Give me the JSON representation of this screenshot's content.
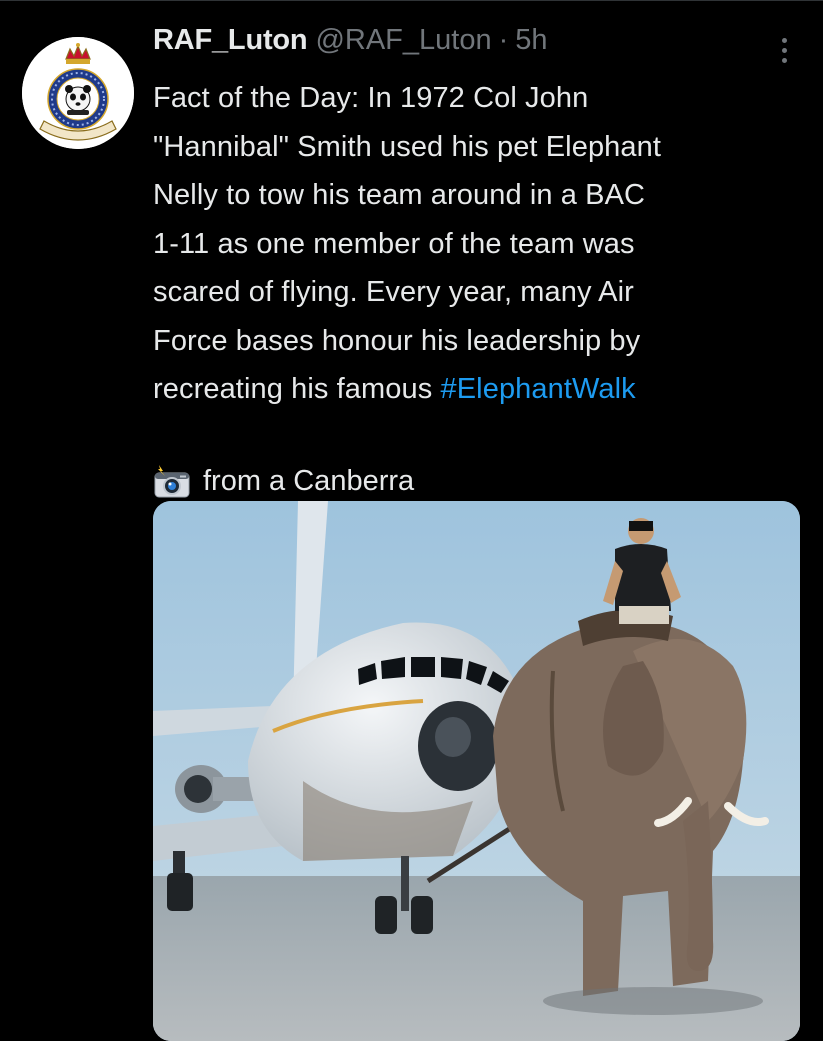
{
  "tweet": {
    "author_name": "RAF_Luton",
    "author_handle": "@RAF_Luton",
    "separator": "·",
    "timestamp": "5h",
    "text_before_hashtag": "Fact of the Day: In 1972 Col John\n\"Hannibal\" Smith used his pet Elephant\nNelly to tow his team around in a BAC\n1-11 as one member of the team was\nscared of flying. Every year, many Air\nForce bases honour his leadership by\nrecreating his famous ",
    "hashtag": "#ElephantWalk",
    "caption_icon": "camera-with-flash-icon",
    "caption_text": "from a Canberra",
    "more_icon": "more-options-icon"
  },
  "avatar": {
    "badge_text_top": "ROYAL AIR FORCE STATION",
    "badge_text_scroll": "LUTON",
    "badge_motto": "ALUDUS DE JOVIS"
  },
  "colors": {
    "background": "#000000",
    "text_primary": "#e7e9ea",
    "text_secondary": "#71767b",
    "link": "#1d9bf0"
  }
}
